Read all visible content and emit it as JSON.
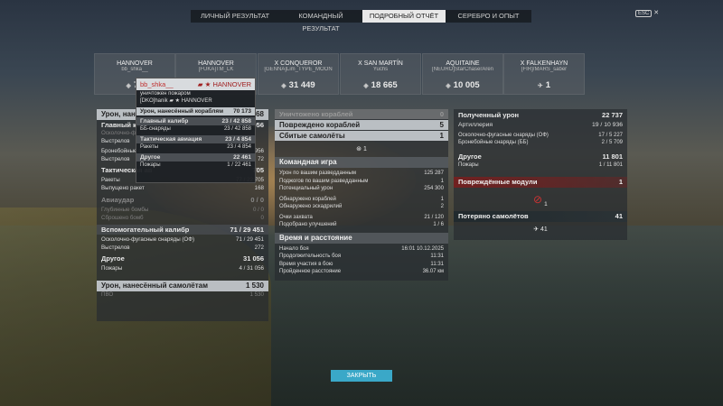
{
  "tabs": [
    "Личный результат",
    "Командный результат",
    "Подробный отчёт",
    "Серебро и опыт"
  ],
  "active_tab": 2,
  "topright": {
    "esc": "ESC",
    "close": "✕"
  },
  "cards": [
    {
      "ship": "HANNOVER",
      "player": "bb_shka__",
      "value": "70",
      "icon": "target"
    },
    {
      "ship": "HANNOVER",
      "player": "[FUKA]TM_LK",
      "value": "",
      "icon": "target"
    },
    {
      "ship": "X CONQUEROR",
      "player": "[GENNA]Lim_TYPE_MOON",
      "value": "31 449",
      "icon": "target"
    },
    {
      "ship": "X SAN MARTÍN",
      "player": "Yuchs",
      "value": "18 665",
      "icon": "target"
    },
    {
      "ship": "AQUITAINE",
      "player": "[NEURO]StarChaserAren",
      "value": "10 005",
      "icon": "target"
    },
    {
      "ship": "X FALKENHAYN",
      "player": "[FIR]/MARS_saber",
      "value": "1",
      "icon": "plane"
    }
  ],
  "left": {
    "header": {
      "label": "Урон, нанесённый кораблям",
      "value": "68"
    },
    "main_cal": {
      "label": "Главный калибр",
      "value": "956"
    },
    "rows1": [
      {
        "label": "Осколочно-фугасные",
        "value": ""
      },
      {
        "label": "Выстрелов",
        "value": ""
      }
    ],
    "armor": {
      "label": "Бронебойные с",
      "value": "956"
    },
    "shots2": {
      "label": "Выстрелов",
      "value": "72"
    },
    "tac": {
      "label": "Тактическая ав",
      "value": "705"
    },
    "rockets": {
      "label": "Ракеты",
      "value": "77 / 22 705"
    },
    "rockets_fired": {
      "label": "Выпущено ракет",
      "value": "168"
    },
    "avia": {
      "label": "Авиаудар",
      "value": "0 / 0"
    },
    "depth": {
      "label": "Глубинные бомбы",
      "value": "0 / 0"
    },
    "dropped": {
      "label": "Сброшено бомб",
      "value": "0"
    },
    "secondary": {
      "label": "Вспомогательный калибр",
      "value": "71 / 29 451"
    },
    "he_shells": {
      "label": "Осколочно-фугасные снаряды (ОФ)",
      "value": "71 / 29 451"
    },
    "shots3": {
      "label": "Выстрелов",
      "value": "272"
    },
    "other": {
      "label": "Другое",
      "value": "31 056"
    },
    "fires": {
      "label": "Пожары",
      "value": "4 / 31 056"
    },
    "air_hdr": {
      "label": "Урон, нанесённый самолётам",
      "value": "1 530"
    },
    "pvo": {
      "label": "ПВО",
      "value": "1 530"
    }
  },
  "tooltip": {
    "player": "bb_shka__",
    "ship": "HANNOVER",
    "destroyed_by": "уничтожен пожаром",
    "killer": "[DKO]hanik",
    "killer_ship": "HANNOVER",
    "dmg_hdr": {
      "label": "Урон, нанесённый кораблям",
      "value": "70 173"
    },
    "mc": {
      "label": "Главный калибр",
      "value": "23 / 42 858"
    },
    "ap": {
      "label": "ББ-снаряды",
      "value": "23 / 42 858"
    },
    "tac": {
      "label": "Тактическая авиация",
      "value": "23 / 4 854"
    },
    "rk": {
      "label": "Ракеты",
      "value": "23 / 4 854"
    },
    "oth": {
      "label": "Другое",
      "value": "22 461"
    },
    "fr": {
      "label": "Пожары",
      "value": "1 / 22 461"
    }
  },
  "middle": {
    "killed": {
      "label": "Уничтожено кораблей",
      "value": "0"
    },
    "damaged": {
      "label": "Повреждено кораблей",
      "value": "5"
    },
    "planes": {
      "label": "Сбитые самолёты",
      "value": "1"
    },
    "plane_icon_val": "1",
    "team_hdr": "Командная игра",
    "team_rows": [
      {
        "label": "Урон по вашим разведданным",
        "value": "125 287"
      },
      {
        "label": "Поджогов по вашим разведданным",
        "value": "1"
      },
      {
        "label": "Потенциальный урон",
        "value": "254 300"
      },
      {
        "label": "Обнаружено кораблей",
        "value": "1"
      },
      {
        "label": "Обнаружено эскадрилий",
        "value": "2"
      },
      {
        "label": "Очки захвата",
        "value": "21 / 120"
      },
      {
        "label": "Подобрано улучшений",
        "value": "1 / 6"
      }
    ],
    "time_hdr": "Время и расстояние",
    "time_rows": [
      {
        "label": "Начало боя",
        "value": "16:01  10.12.2025"
      },
      {
        "label": "Продолжительность боя",
        "value": "11:31"
      },
      {
        "label": "Время участия в бою",
        "value": "11:31"
      },
      {
        "label": "Пройденное расстояние",
        "value": "36.07 км"
      }
    ]
  },
  "right": {
    "recv": {
      "label": "Полученный урон",
      "value": "22 737"
    },
    "art": {
      "label": "Артиллерия",
      "value": "19 / 10 936"
    },
    "he": {
      "label": "Осколочно-фугасные снаряды (ОФ)",
      "value": "17 / 5 227"
    },
    "ap": {
      "label": "Бронебойные снаряды (ББ)",
      "value": "2 / 5 709"
    },
    "other": {
      "label": "Другое",
      "value": "11 801"
    },
    "fires": {
      "label": "Пожары",
      "value": "1 / 11 801"
    },
    "modules": {
      "label": "Повреждённые модули",
      "value": "1"
    },
    "mod_icon_val": "1",
    "lost": {
      "label": "Потеряно самолётов",
      "value": "41"
    },
    "lost_icon_val": "41"
  },
  "close_label": "Закрыть"
}
